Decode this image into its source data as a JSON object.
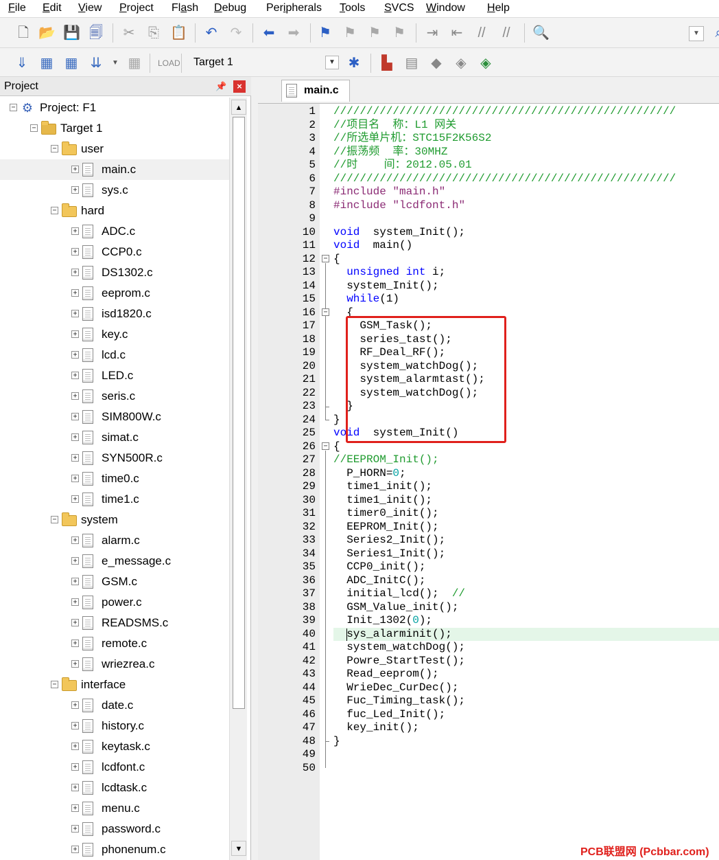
{
  "menu": [
    {
      "label": "File",
      "key": "F",
      "rest": "ile"
    },
    {
      "label": "Edit",
      "key": "E",
      "rest": "dit"
    },
    {
      "label": "View",
      "key": "V",
      "rest": "iew"
    },
    {
      "label": "Project",
      "key": "P",
      "rest": "roject"
    },
    {
      "label": "Flash",
      "key": "",
      "rest": "Fl",
      "key2": "a",
      "rest2": "sh"
    },
    {
      "label": "Debug",
      "key": "D",
      "rest": "ebug"
    },
    {
      "label": "Peripherals",
      "key": "",
      "rest": "Per",
      "key2": "i",
      "rest2": "pherals"
    },
    {
      "label": "Tools",
      "key": "T",
      "rest": "ools"
    },
    {
      "label": "SVCS",
      "key": "S",
      "rest": "VCS"
    },
    {
      "label": "Window",
      "key": "W",
      "rest": "indow"
    },
    {
      "label": "Help",
      "key": "H",
      "rest": "elp"
    }
  ],
  "toolbar2": {
    "target": "Target 1"
  },
  "project": {
    "title": "Project",
    "root": "Project: F1",
    "target": "Target 1",
    "groups": [
      {
        "name": "user",
        "files": [
          "main.c",
          "sys.c"
        ]
      },
      {
        "name": "hard",
        "files": [
          "ADC.c",
          "CCP0.c",
          "DS1302.c",
          "eeprom.c",
          "isd1820.c",
          "key.c",
          "lcd.c",
          "LED.c",
          "seris.c",
          "SIM800W.c",
          "simat.c",
          "SYN500R.c",
          "time0.c",
          "time1.c"
        ]
      },
      {
        "name": "system",
        "files": [
          "alarm.c",
          "e_message.c",
          "GSM.c",
          "power.c",
          "READSMS.c",
          "remote.c",
          "wriezrea.c"
        ]
      },
      {
        "name": "interface",
        "files": [
          "date.c",
          "history.c",
          "keytask.c",
          "lcdfont.c",
          "lcdtask.c",
          "menu.c",
          "password.c",
          "phonenum.c"
        ]
      }
    ]
  },
  "editor": {
    "tab": "main.c",
    "lines": [
      [
        [
          "cmt",
          "////////////////////////////////////////////////////"
        ]
      ],
      [
        [
          "cmt",
          "//项目名  称：L1 网关"
        ]
      ],
      [
        [
          "cmt",
          "//所选单片机：STC15F2K56S2"
        ]
      ],
      [
        [
          "cmt",
          "//振荡频  率：30MHZ"
        ]
      ],
      [
        [
          "cmt",
          "//时    间：2012.05.01"
        ]
      ],
      [
        [
          "cmt",
          "////////////////////////////////////////////////////"
        ]
      ],
      [
        [
          "pp",
          "#include "
        ],
        [
          "str",
          "\"main.h\""
        ]
      ],
      [
        [
          "pp",
          "#include "
        ],
        [
          "str",
          "\"lcdfont.h\""
        ]
      ],
      [],
      [
        [
          "kw",
          "void"
        ],
        [
          "",
          "  system_Init();"
        ]
      ],
      [
        [
          "kw",
          "void"
        ],
        [
          "",
          "  main()"
        ]
      ],
      [
        [
          "",
          "{"
        ]
      ],
      [
        [
          "",
          "  "
        ],
        [
          "kw",
          "unsigned int"
        ],
        [
          "",
          " i;"
        ]
      ],
      [
        [
          "",
          "  system_Init();"
        ]
      ],
      [
        [
          "",
          "  "
        ],
        [
          "kw",
          "while"
        ],
        [
          "",
          "(1)"
        ]
      ],
      [
        [
          "",
          "  {"
        ]
      ],
      [
        [
          "",
          "    GSM_Task();"
        ]
      ],
      [
        [
          "",
          "    series_tast();"
        ]
      ],
      [
        [
          "",
          "    RF_Deal_RF();"
        ]
      ],
      [
        [
          "",
          "    system_watchDog();"
        ]
      ],
      [
        [
          "",
          "    system_alarmtast();"
        ]
      ],
      [
        [
          "",
          "    system_watchDog();"
        ]
      ],
      [
        [
          "",
          "  }"
        ]
      ],
      [
        [
          "",
          "}"
        ]
      ],
      [
        [
          "kw",
          "void"
        ],
        [
          "",
          "  system_Init()"
        ]
      ],
      [
        [
          "",
          "{"
        ]
      ],
      [
        [
          "cmt",
          "//EEPROM_Init();"
        ]
      ],
      [
        [
          "",
          "  P_HORN="
        ],
        [
          "num",
          "0"
        ],
        [
          "",
          ";"
        ]
      ],
      [
        [
          "",
          "  time1_init();"
        ]
      ],
      [
        [
          "",
          "  time1_init();"
        ]
      ],
      [
        [
          "",
          "  timer0_init();"
        ]
      ],
      [
        [
          "",
          "  EEPROM_Init();"
        ]
      ],
      [
        [
          "",
          "  Series2_Init();"
        ]
      ],
      [
        [
          "",
          "  Series1_Init();"
        ]
      ],
      [
        [
          "",
          "  CCP0_init();"
        ]
      ],
      [
        [
          "",
          "  ADC_InitC();"
        ]
      ],
      [
        [
          "",
          "  initial_lcd();  "
        ],
        [
          "cmt",
          "//"
        ]
      ],
      [
        [
          "",
          "  GSM_Value_init();"
        ]
      ],
      [
        [
          "",
          "  Init_1302("
        ],
        [
          "num",
          "0"
        ],
        [
          "",
          ");"
        ]
      ],
      [
        [
          "",
          "  sys_alarminit();"
        ]
      ],
      [
        [
          "",
          "  system_watchDog();"
        ]
      ],
      [
        [
          "",
          "  Powre_StartTest();"
        ]
      ],
      [
        [
          "",
          "  Read_eeprom();"
        ]
      ],
      [
        [
          "",
          "  WrieDec_CurDec();"
        ]
      ],
      [
        [
          "",
          "  Fuc_Timing_task();"
        ]
      ],
      [
        [
          "",
          "  fuc_Led_Init();"
        ]
      ],
      [
        [
          "",
          "  key_init();"
        ]
      ],
      [
        [
          "",
          "}"
        ]
      ],
      [],
      []
    ],
    "highlight_line": 40
  },
  "watermark": "PCB联盟网 (Pcbbar.com)"
}
